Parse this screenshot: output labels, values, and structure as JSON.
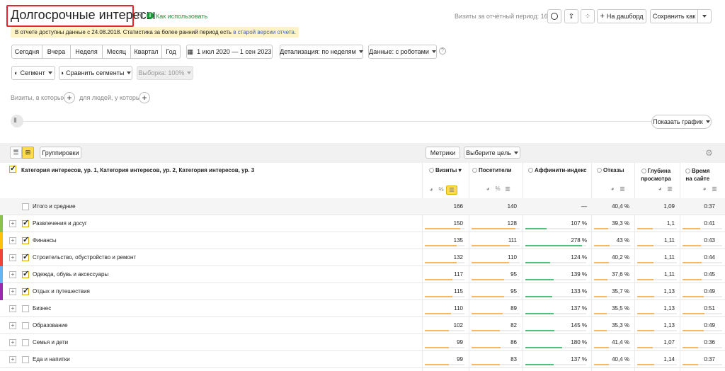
{
  "header": {
    "title": "Долгосрочные интересы",
    "how_to": "Как использовать",
    "visits_label": "Визиты за отчётный период: 166",
    "add_dashboard": "На дашборд",
    "save_as": "Сохранить как"
  },
  "notice": {
    "text": "В отчете доступны данные с 24.08.2018. Статистика за более ранний период есть ",
    "link": "в старой версии отчета."
  },
  "period_tabs": [
    "Сегодня",
    "Вчера",
    "Неделя",
    "Месяц",
    "Квартал",
    "Год"
  ],
  "date_range": "1 июл 2020 — 1 сен 2023",
  "detail": "Детализация: по неделям",
  "data_mode": "Данные: с роботами",
  "segment": "Сегмент",
  "compare": "Сравнить сегменты",
  "sample": "Выборка: 100%",
  "filters": {
    "visits_where": "Визиты, в которых",
    "people_where": "для людей, у которых"
  },
  "show_chart": "Показать график",
  "table_toolbar": {
    "groupings": "Группировки",
    "metrics": "Метрики",
    "goal": "Выберите цель"
  },
  "table": {
    "dimension_header": "Категория интересов, ур. 1, Категория интересов, ур. 2, Категория интересов, ур. 3",
    "columns": [
      "Визиты",
      "Посетители",
      "Аффинити-индекс",
      "Отказы",
      "Глубина просмотра",
      "Время на сайте"
    ],
    "col_depth": [
      "Глубина",
      "просмотра"
    ],
    "col_time": [
      "Время",
      "на сайте"
    ],
    "totals": {
      "name": "Итого и средние",
      "values": [
        "166",
        "140",
        "—",
        "40,4 %",
        "1,09",
        "0:37"
      ]
    },
    "rows": [
      {
        "name": "Развлечения и досуг",
        "values": [
          "150",
          "128",
          "107 %",
          "39,3 %",
          "1,1",
          "0:41"
        ],
        "checked": true,
        "color": "#8bc34a",
        "visits": 0.9,
        "visitors": 0.91,
        "affinity": 0.35,
        "bounce": 0.39,
        "depth": 0.4,
        "time": 0.45
      },
      {
        "name": "Финансы",
        "values": [
          "135",
          "111",
          "278 %",
          "43 %",
          "1,11",
          "0:43"
        ],
        "checked": true,
        "color": "#ffc107",
        "visits": 0.81,
        "visitors": 0.79,
        "affinity": 0.93,
        "bounce": 0.43,
        "depth": 0.41,
        "time": 0.47
      },
      {
        "name": "Строительство, обустройство и ремонт",
        "values": [
          "132",
          "110",
          "124 %",
          "40,2 %",
          "1,11",
          "0:44"
        ],
        "checked": true,
        "color": "#f44336",
        "visits": 0.8,
        "visitors": 0.78,
        "affinity": 0.41,
        "bounce": 0.4,
        "depth": 0.41,
        "time": 0.48
      },
      {
        "name": "Одежда, обувь и аксессуары",
        "values": [
          "117",
          "95",
          "139 %",
          "37,6 %",
          "1,11",
          "0:45"
        ],
        "checked": true,
        "color": "#64b5f6",
        "visits": 0.7,
        "visitors": 0.68,
        "affinity": 0.46,
        "bounce": 0.37,
        "depth": 0.41,
        "time": 0.49
      },
      {
        "name": "Отдых и путешествия",
        "values": [
          "115",
          "95",
          "133 %",
          "35,7 %",
          "1,13",
          "0:49"
        ],
        "checked": true,
        "color": "#9c27b0",
        "visits": 0.69,
        "visitors": 0.68,
        "affinity": 0.44,
        "bounce": 0.35,
        "depth": 0.42,
        "time": 0.53
      },
      {
        "name": "Бизнес",
        "values": [
          "110",
          "89",
          "137 %",
          "35,5 %",
          "1,13",
          "0:51"
        ],
        "checked": false,
        "color": "",
        "visits": 0.66,
        "visitors": 0.64,
        "affinity": 0.46,
        "bounce": 0.35,
        "depth": 0.42,
        "time": 0.55
      },
      {
        "name": "Образование",
        "values": [
          "102",
          "82",
          "145 %",
          "35,3 %",
          "1,13",
          "0:49"
        ],
        "checked": false,
        "color": "",
        "visits": 0.61,
        "visitors": 0.59,
        "affinity": 0.48,
        "bounce": 0.35,
        "depth": 0.42,
        "time": 0.53
      },
      {
        "name": "Семья и дети",
        "values": [
          "99",
          "86",
          "180 %",
          "41,4 %",
          "1,07",
          "0:36"
        ],
        "checked": false,
        "color": "",
        "visits": 0.6,
        "visitors": 0.61,
        "affinity": 0.6,
        "bounce": 0.41,
        "depth": 0.4,
        "time": 0.39
      },
      {
        "name": "Еда и напитки",
        "values": [
          "99",
          "83",
          "137 %",
          "40,4 %",
          "1,14",
          "0:37"
        ],
        "checked": false,
        "color": "",
        "visits": 0.6,
        "visitors": 0.59,
        "affinity": 0.46,
        "bounce": 0.4,
        "depth": 0.42,
        "time": 0.4
      }
    ]
  },
  "colors": {
    "accent": "#ffdb4d",
    "link": "#4062b7",
    "green": "#1a9a3a",
    "bar_orange": "#f5b865",
    "bar_green": "#53c07a",
    "title_border": "#e0262e"
  }
}
